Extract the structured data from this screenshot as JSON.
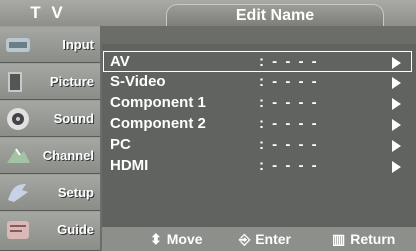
{
  "header": {
    "tv_title": "T V",
    "page_title": "Edit Name"
  },
  "sidebar": {
    "items": [
      {
        "label": "Input",
        "icon": "input-icon",
        "color": "#b9c7cf"
      },
      {
        "label": "Picture",
        "icon": "picture-icon",
        "color": "#c8c8c8"
      },
      {
        "label": "Sound",
        "icon": "sound-icon",
        "color": "#e1e1e1"
      },
      {
        "label": "Channel",
        "icon": "channel-icon",
        "color": "#a2c3a4"
      },
      {
        "label": "Setup",
        "icon": "setup-icon",
        "color": "#c9d2e4"
      },
      {
        "label": "Guide",
        "icon": "guide-icon",
        "color": "#d9b8b8"
      }
    ]
  },
  "list": {
    "rows": [
      {
        "label": "AV",
        "value": ": - - - -"
      },
      {
        "label": "S-Video",
        "value": ": - - - -"
      },
      {
        "label": "Component 1",
        "value": ": - - - -"
      },
      {
        "label": "Component 2",
        "value": ": - - - -"
      },
      {
        "label": "PC",
        "value": ": - - - -"
      },
      {
        "label": "HDMI",
        "value": ": - - - -"
      }
    ]
  },
  "help": {
    "move": "Move",
    "enter": "Enter",
    "return": "Return"
  }
}
